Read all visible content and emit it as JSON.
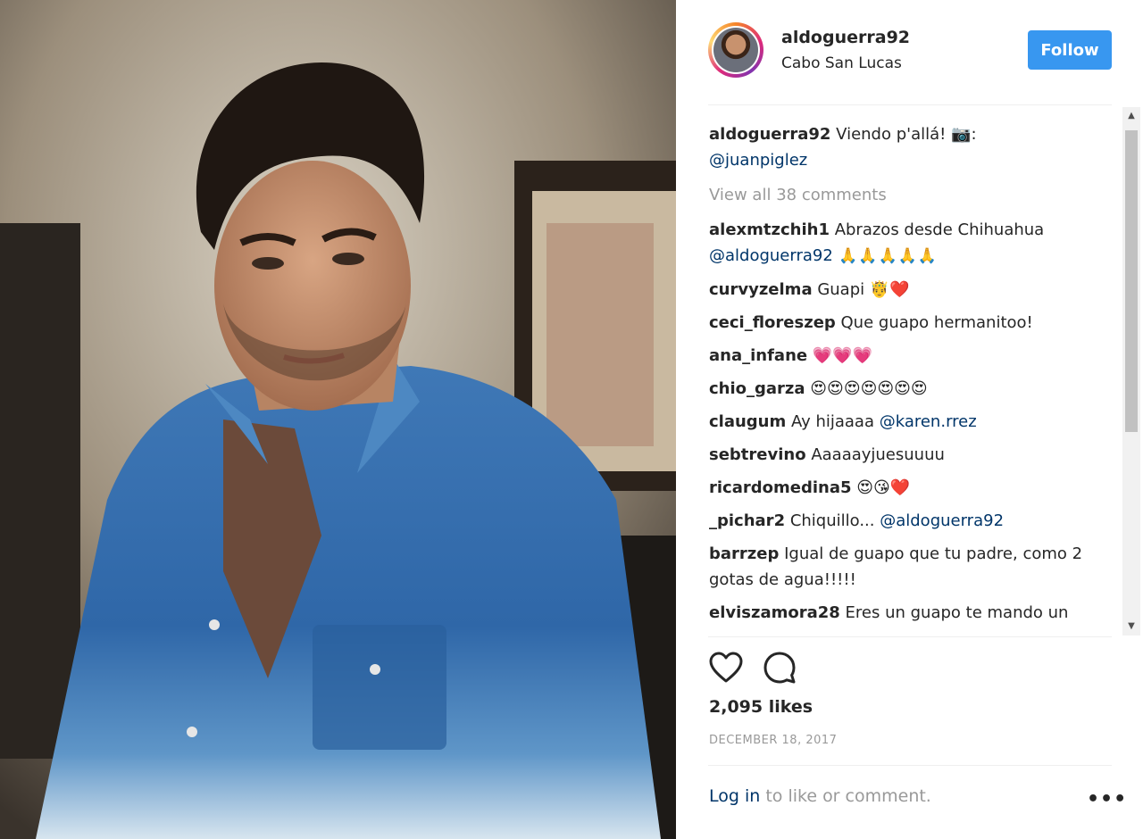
{
  "post": {
    "photo_alt": "Man with dark hair wearing a blue denim shirt",
    "author": {
      "username": "aldoguerra92",
      "location": "Cabo San Lucas",
      "follow_label": "Follow"
    },
    "caption": {
      "username": "aldoguerra92",
      "text": " Viendo p'allá! 📷:",
      "mention": "@juanpiglez"
    },
    "view_all": "View all 38 comments",
    "comments": [
      {
        "username": "alexmtzchih1",
        "text": " Abrazos desde Chihuahua ",
        "mention": "@aldoguerra92",
        "after": " 🙏🙏🙏🙏🙏"
      },
      {
        "username": "curvyzelma",
        "text": " Guapi 🤴❤️",
        "mention": "",
        "after": ""
      },
      {
        "username": "ceci_floreszep",
        "text": " Que guapo hermanitoo!",
        "mention": "",
        "after": ""
      },
      {
        "username": "ana_infane",
        "text": " 💗💗💗",
        "mention": "",
        "after": ""
      },
      {
        "username": "chio_garza",
        "text": " 😍😍😍😍😍😍😍",
        "mention": "",
        "after": ""
      },
      {
        "username": "claugum",
        "text": " Ay hijaaaa ",
        "mention": "@karen.rrez",
        "after": ""
      },
      {
        "username": "sebtrevino",
        "text": " Aaaaayjuesuuuu",
        "mention": "",
        "after": ""
      },
      {
        "username": "ricardomedina5",
        "text": " 😍😘❤️",
        "mention": "",
        "after": ""
      },
      {
        "username": "_pichar2",
        "text": " Chiquillo... ",
        "mention": "@aldoguerra92",
        "after": ""
      },
      {
        "username": "barrzep",
        "text": " Igual de guapo que tu padre, como 2 gotas de agua!!!!!",
        "mention": "",
        "after": ""
      },
      {
        "username": "elviszamora28",
        "text": " Eres un guapo te mando un",
        "mention": "",
        "after": ""
      }
    ],
    "likes": "2,095 likes",
    "date": "DECEMBER 18, 2017",
    "footer": {
      "login_link": "Log in",
      "rest": " to like or comment."
    },
    "more_label": "•••"
  },
  "icons": {
    "like": "heart-outline-icon",
    "comment": "comment-bubble-icon",
    "more": "ellipsis-icon"
  },
  "colors": {
    "follow_bg": "#3897f0",
    "link": "#003569",
    "muted": "#999999",
    "text": "#262626"
  }
}
